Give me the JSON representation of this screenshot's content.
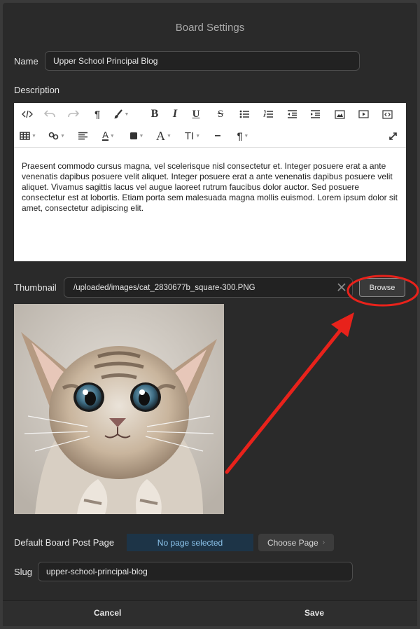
{
  "dialog": {
    "title": "Board Settings"
  },
  "name": {
    "label": "Name",
    "value": "Upper School Principal Blog"
  },
  "description": {
    "label": "Description",
    "content": "Praesent commodo cursus magna, vel scelerisque nisl consectetur et. Integer posuere erat a ante venenatis dapibus posuere velit aliquet. Integer posuere erat a ante venenatis dapibus posuere velit aliquet. Vivamus sagittis lacus vel augue laoreet rutrum faucibus dolor auctor. Sed posuere consectetur est at lobortis. Etiam porta sem malesuada magna mollis euismod. Lorem ipsum dolor sit amet, consectetur adipiscing elit."
  },
  "toolbar": {
    "bold": "B",
    "italic": "I",
    "underline": "U",
    "strikethrough": "S",
    "paragraph": "¶",
    "font_color": "A",
    "font_size": "A",
    "text_transform": "TI",
    "hr": "–",
    "line_height": "¶"
  },
  "thumbnail": {
    "label": "Thumbnail",
    "value": "/uploaded/images/cat_2830677b_square-300.PNG",
    "browse_label": "Browse"
  },
  "default_page": {
    "label": "Default Board Post Page",
    "selected": "No page selected",
    "choose_label": "Choose Page"
  },
  "slug": {
    "label": "Slug",
    "value": "upper-school-principal-blog"
  },
  "footer": {
    "cancel_label": "Cancel",
    "save_label": "Save"
  },
  "colors": {
    "annotation": "#e8221b",
    "selected_bg": "#1d3447",
    "selected_text": "#8cc4ec"
  }
}
